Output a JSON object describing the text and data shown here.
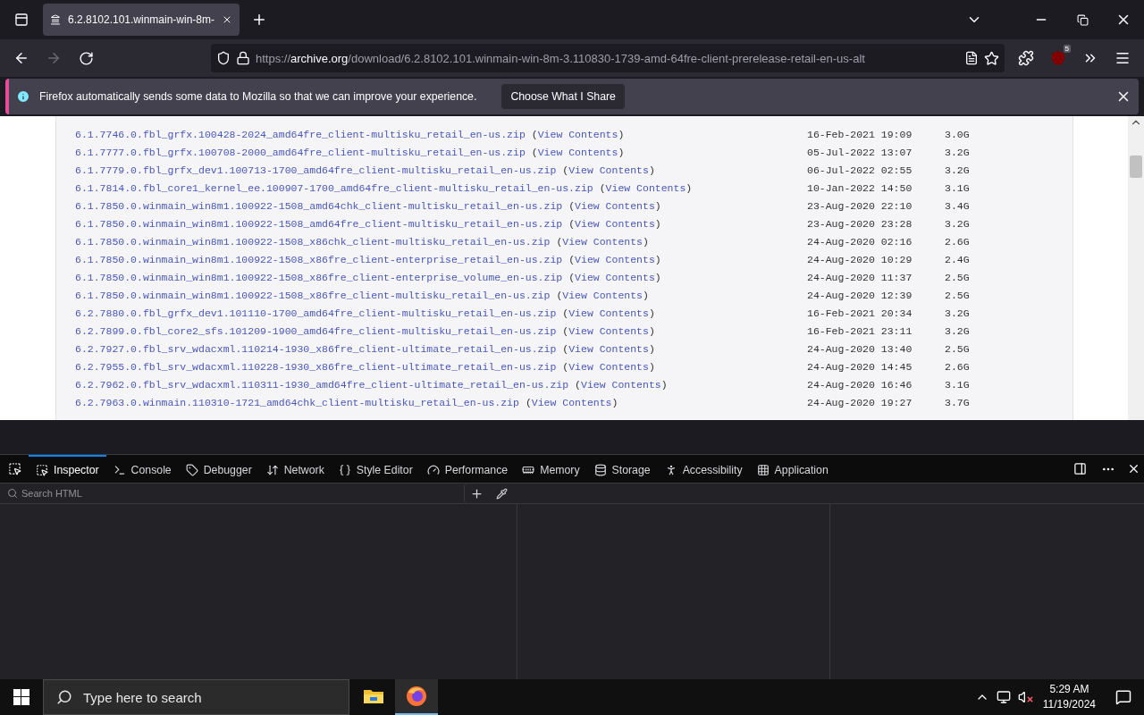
{
  "browser": {
    "tabs": [
      {
        "title": "6.2.8102.101.winmain-win-8m-",
        "selected": true
      }
    ],
    "address": {
      "scheme": "https://",
      "host": "archive.org",
      "path": "/download/6.2.8102.101.winmain-win-8m-3.110830-1739-amd-64fre-client-prerelease-retail-en-us-alt"
    },
    "forward_disabled": true,
    "extension_badge": "5",
    "notification": {
      "text": "Firefox automatically sends some data to Mozilla so that we can improve your experience.",
      "button": "Choose What I Share"
    }
  },
  "listing": {
    "rows": [
      {
        "file": "6.1.7746.0.fbl_grfx.100428-2024_amd64fre_client-multisku_retail_en-us.zip",
        "open": "(",
        "link": "View Contents",
        "close": ")",
        "date": "16-Feb-2021 19:09",
        "size": "3.0G"
      },
      {
        "file": "6.1.7777.0.fbl_grfx.100708-2000_amd64fre_client-multisku_retail_en-us.zip",
        "open": "(",
        "link": "View Contents",
        "close": ")",
        "date": "05-Jul-2022 13:07",
        "size": "3.2G"
      },
      {
        "file": "6.1.7779.0.fbl_grfx_dev1.100713-1700_amd64fre_client-multisku_retail_en-us.zip",
        "open": "(",
        "link": "View Contents",
        "close": ")",
        "date": "06-Jul-2022 02:55",
        "size": "3.2G"
      },
      {
        "file": "6.1.7814.0.fbl_core1_kernel_ee.100907-1700_amd64fre_client-multisku_retail_en-us.zip",
        "open": "(",
        "link": "View Contents",
        "close": ")",
        "date": "10-Jan-2022 14:50",
        "size": "3.1G"
      },
      {
        "file": "6.1.7850.0.winmain_win8m1.100922-1508_amd64chk_client-multisku_retail_en-us.zip",
        "open": "(",
        "link": "View Contents",
        "close": ")",
        "date": "23-Aug-2020 22:10",
        "size": "3.4G"
      },
      {
        "file": "6.1.7850.0.winmain_win8m1.100922-1508_amd64fre_client-multisku_retail_en-us.zip",
        "open": "(",
        "link": "View Contents",
        "close": ")",
        "date": "23-Aug-2020 23:28",
        "size": "3.2G"
      },
      {
        "file": "6.1.7850.0.winmain_win8m1.100922-1508_x86chk_client-multisku_retail_en-us.zip",
        "open": "(",
        "link": "View Contents",
        "close": ")",
        "date": "24-Aug-2020 02:16",
        "size": "2.6G"
      },
      {
        "file": "6.1.7850.0.winmain_win8m1.100922-1508_x86fre_client-enterprise_retail_en-us.zip",
        "open": "(",
        "link": "View Contents",
        "close": ")",
        "date": "24-Aug-2020 10:29",
        "size": "2.4G"
      },
      {
        "file": "6.1.7850.0.winmain_win8m1.100922-1508_x86fre_client-enterprise_volume_en-us.zip",
        "open": "(",
        "link": "View Contents",
        "close": ")",
        "date": "24-Aug-2020 11:37",
        "size": "2.5G"
      },
      {
        "file": "6.1.7850.0.winmain_win8m1.100922-1508_x86fre_client-multisku_retail_en-us.zip",
        "open": "(",
        "link": "View Contents",
        "close": ")",
        "date": "24-Aug-2020 12:39",
        "size": "2.5G"
      },
      {
        "file": "6.2.7880.0.fbl_grfx_dev1.101110-1700_amd64fre_client-multisku_retail_en-us.zip",
        "open": "(",
        "link": "View Contents",
        "close": ")",
        "date": "16-Feb-2021 20:34",
        "size": "3.2G"
      },
      {
        "file": "6.2.7899.0.fbl_core2_sfs.101209-1900_amd64fre_client-multisku_retail_en-us.zip",
        "open": "(",
        "link": "View Contents",
        "close": ")",
        "date": "16-Feb-2021 23:11",
        "size": "3.2G"
      },
      {
        "file": "6.2.7927.0.fbl_srv_wdacxml.110214-1930_x86fre_client-ultimate_retail_en-us.zip",
        "open": "(",
        "link": "View Contents",
        "close": ")",
        "date": "24-Aug-2020 13:40",
        "size": "2.5G"
      },
      {
        "file": "6.2.7955.0.fbl_srv_wdacxml.110228-1930_x86fre_client-ultimate_retail_en-us.zip",
        "open": "(",
        "link": "View Contents",
        "close": ")",
        "date": "24-Aug-2020 14:45",
        "size": "2.6G"
      },
      {
        "file": "6.2.7962.0.fbl_srv_wdacxml.110311-1930_amd64fre_client-ultimate_retail_en-us.zip",
        "open": "(",
        "link": "View Contents",
        "close": ")",
        "date": "24-Aug-2020 16:46",
        "size": "3.1G"
      },
      {
        "file": "6.2.7963.0.winmain.110310-1721_amd64chk_client-multisku_retail_en-us.zip",
        "open": "(",
        "link": "View Contents",
        "close": ")",
        "date": "24-Aug-2020 19:27",
        "size": "3.7G"
      }
    ]
  },
  "devtools": {
    "tabs": [
      {
        "label": "Inspector",
        "selected": true
      },
      {
        "label": "Console",
        "selected": false
      },
      {
        "label": "Debugger",
        "selected": false
      },
      {
        "label": "Network",
        "selected": false
      },
      {
        "label": "Style Editor",
        "selected": false
      },
      {
        "label": "Performance",
        "selected": false
      },
      {
        "label": "Memory",
        "selected": false
      },
      {
        "label": "Storage",
        "selected": false
      },
      {
        "label": "Accessibility",
        "selected": false
      },
      {
        "label": "Application",
        "selected": false
      }
    ],
    "search": {
      "placeholder": "Search HTML"
    }
  },
  "taskbar": {
    "search": {
      "placeholder": "Type here to search"
    },
    "apps": [
      {
        "kind": "folder",
        "active": false
      },
      {
        "kind": "firefox",
        "active": true
      }
    ],
    "volume_muted": true,
    "time": "5:29 AM",
    "date": "11/19/2024"
  }
}
